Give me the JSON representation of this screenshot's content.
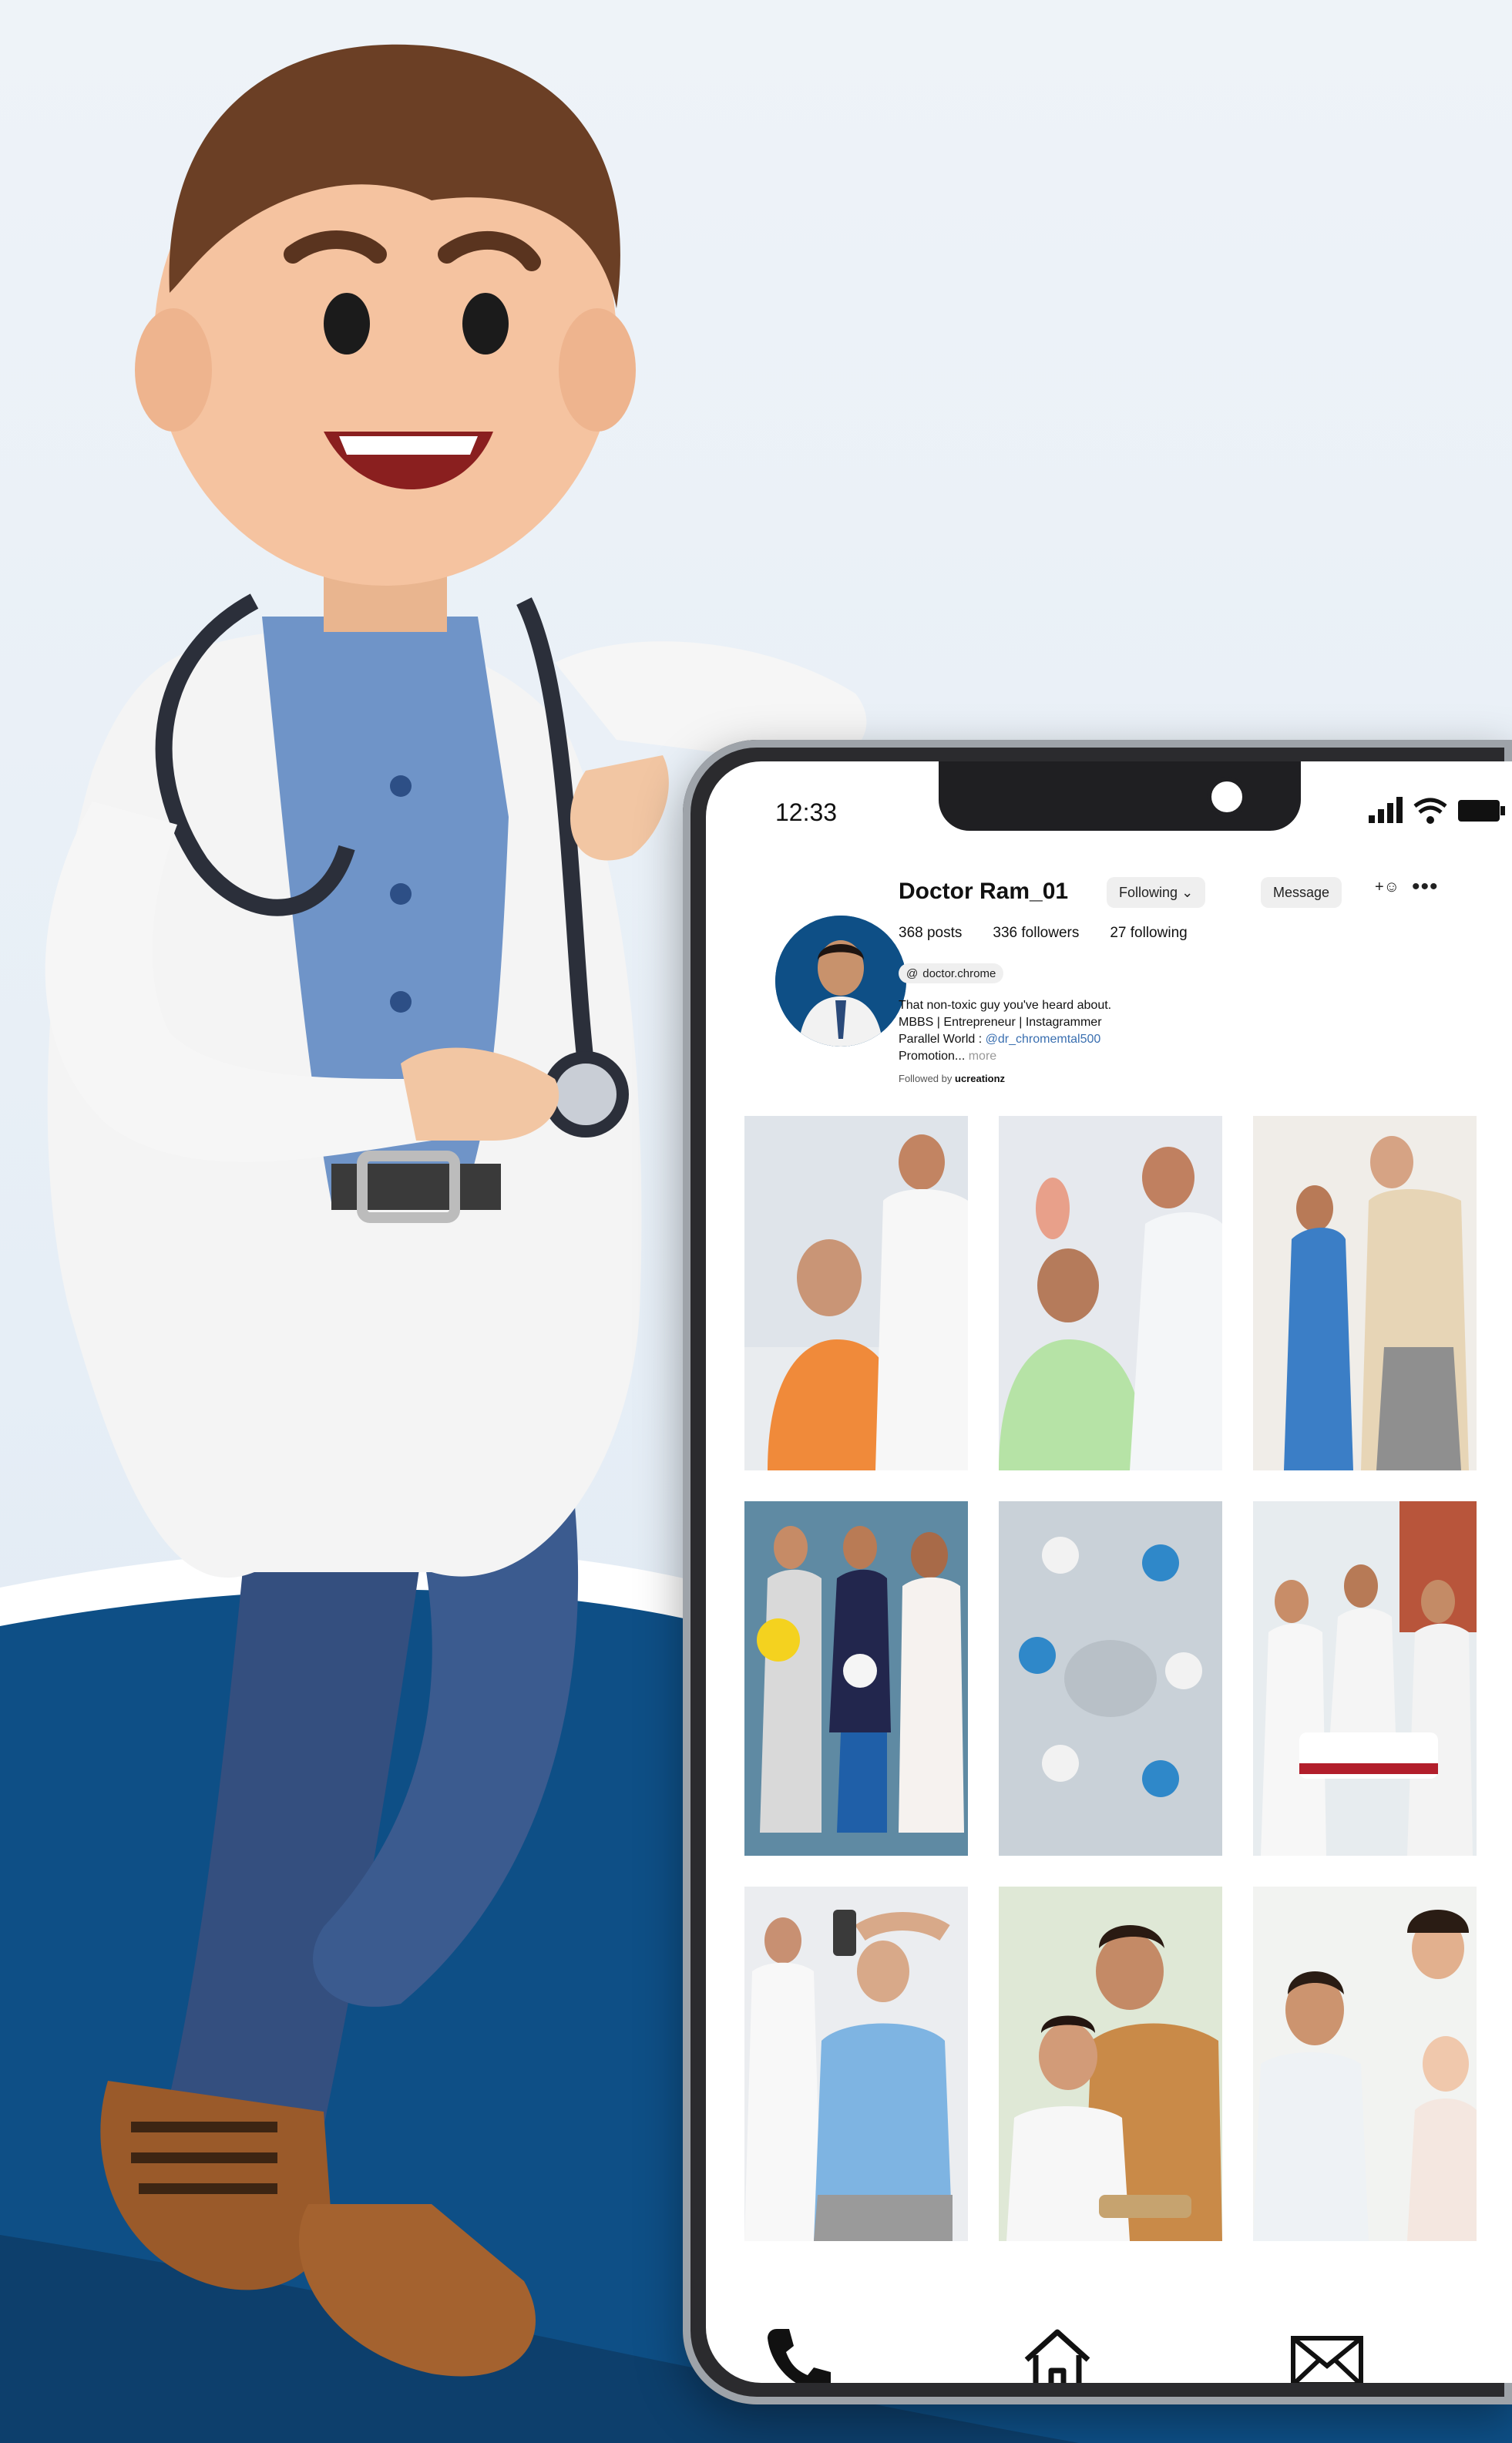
{
  "status_bar": {
    "time": "12:33"
  },
  "profile": {
    "username": "Doctor Ram_01",
    "following_button": "Following",
    "message_button": "Message",
    "stats": {
      "posts": "368 posts",
      "followers": "336 followers",
      "following": "27 following"
    },
    "threads_handle": "doctor.chrome",
    "bio": {
      "line1": "That non-toxic guy you've heard about.",
      "line2": "MBBS | Entrepreneur | Instagrammer",
      "line3_prefix": "Parallel World :",
      "line3_link": "@dr_chromemtal500",
      "line4": "Promotion...",
      "line4_more": "more"
    },
    "followed_by_prefix": "Followed by",
    "followed_by_user": "ucreationz"
  },
  "grid": {
    "tiles": [
      "Doctor reassuring elderly man in orange shirt",
      "Doctor with smiling elderly woman",
      "Nurse helping elderly man walk",
      "Three people with helmet, football and books",
      "Medical team meeting seen from above",
      "Doctors with patient on hospital stretcher",
      "Doctor helping elderly man exercise with dumbbell",
      "Mother hugging smiling boy",
      "Doctor playing with baby held by mother"
    ]
  },
  "colors": {
    "brand_blue": "#0e4f86",
    "dark_navy": "#0b2f52",
    "phone_frame": "#2b2b2e",
    "link_blue": "#3a6fb0"
  },
  "icons": {
    "nav": [
      "phone-icon",
      "home-icon",
      "mail-icon"
    ],
    "status": [
      "signal-icon",
      "wifi-icon",
      "battery-icon"
    ]
  }
}
